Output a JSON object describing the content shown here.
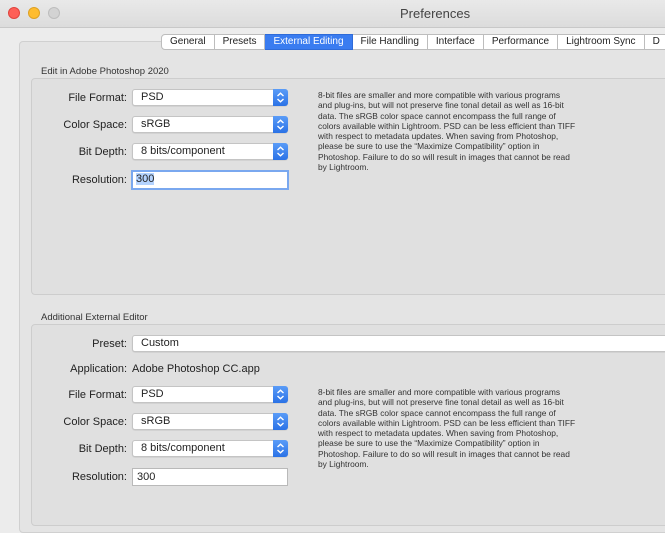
{
  "window": {
    "title": "Preferences"
  },
  "tabs": [
    {
      "label": "General"
    },
    {
      "label": "Presets"
    },
    {
      "label": "External Editing",
      "active": true
    },
    {
      "label": "File Handling"
    },
    {
      "label": "Interface"
    },
    {
      "label": "Performance"
    },
    {
      "label": "Lightroom Sync"
    },
    {
      "label": "D"
    }
  ],
  "edit_in_photoshop": {
    "title": "Edit in Adobe Photoshop 2020",
    "file_format": {
      "label": "File Format:",
      "value": "PSD"
    },
    "color_space": {
      "label": "Color Space:",
      "value": "sRGB"
    },
    "bit_depth": {
      "label": "Bit Depth:",
      "value": "8 bits/component"
    },
    "resolution": {
      "label": "Resolution:",
      "value": "300"
    },
    "info": "8-bit files are smaller and more compatible with various programs\nand plug-ins, but will not preserve fine tonal detail as well as 16-bit\ndata. The sRGB color space cannot encompass the full range of\ncolors available within Lightroom. PSD can be less efficient than TIFF\nwith respect to metadata updates. When saving from Photoshop,\nplease be sure to use the “Maximize Compatibility” option in\nPhotoshop. Failure to do so will result in images that cannot be read\nby Lightroom."
  },
  "additional_editor": {
    "title": "Additional External Editor",
    "preset": {
      "label": "Preset:",
      "value": "Custom"
    },
    "application": {
      "label": "Application:",
      "value": "Adobe Photoshop CC.app"
    },
    "file_format": {
      "label": "File Format:",
      "value": "PSD"
    },
    "color_space": {
      "label": "Color Space:",
      "value": "sRGB"
    },
    "bit_depth": {
      "label": "Bit Depth:",
      "value": "8 bits/component"
    },
    "resolution": {
      "label": "Resolution:",
      "value": "300"
    },
    "info": "8-bit files are smaller and more compatible with various programs\nand plug-ins, but will not preserve fine tonal detail as well as 16-bit\ndata. The sRGB color space cannot encompass the full range of\ncolors available within Lightroom. PSD can be less efficient than TIFF\nwith respect to metadata updates. When saving from Photoshop,\nplease be sure to use the “Maximize Compatibility” option in\nPhotoshop. Failure to do so will result in images that cannot be read\nby Lightroom."
  },
  "colors": {
    "accent": "#3a7cf0",
    "close": "#fe5f57",
    "minimize": "#febc2e",
    "zoom": "#d3d3d3"
  }
}
